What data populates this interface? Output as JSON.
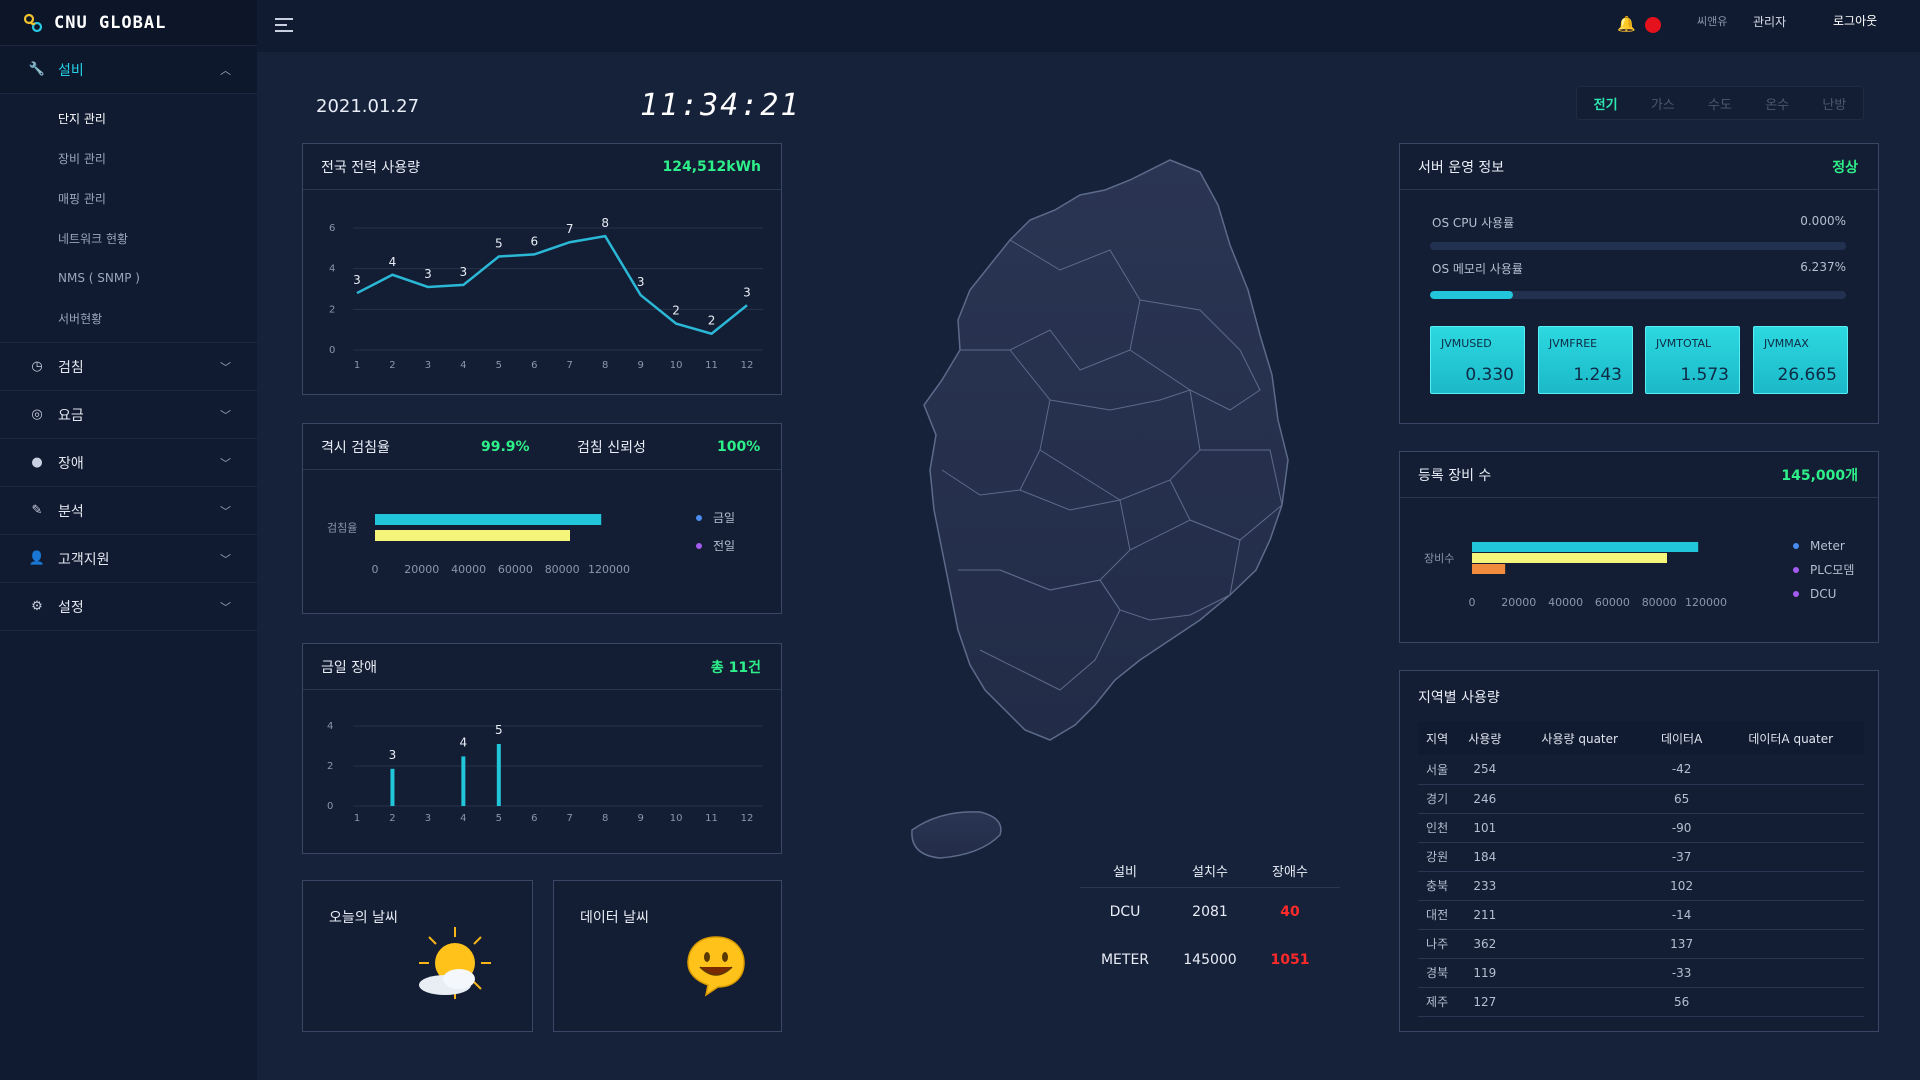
{
  "brand": {
    "name": "CNU GLOBAL"
  },
  "sidebar": {
    "groups": [
      {
        "label": "설비",
        "icon": "wrench-icon",
        "expanded": true,
        "items": [
          "단지 관리",
          "장비 관리",
          "매핑 관리",
          "네트워크 현황",
          "NMS ( SNMP )",
          "서버현황"
        ]
      },
      {
        "label": "검침",
        "icon": "gauge-icon"
      },
      {
        "label": "요금",
        "icon": "coins-icon"
      },
      {
        "label": "장애",
        "icon": "alert-icon"
      },
      {
        "label": "분석",
        "icon": "pencil-icon"
      },
      {
        "label": "고객지원",
        "icon": "user-icon"
      },
      {
        "label": "설정",
        "icon": "gear-icon"
      }
    ]
  },
  "header": {
    "user": "씨앤유",
    "role": "관리자",
    "logout": "로그아웃"
  },
  "datetime": {
    "date": "2021.01.27",
    "time": "11:34:21"
  },
  "utility_tabs": [
    "전기",
    "가스",
    "수도",
    "온수",
    "난방"
  ],
  "active_utility": "전기",
  "power_panel": {
    "title": "전국 전력 사용량",
    "total": "124,512kWh",
    "chart_data": {
      "type": "line",
      "x": [
        1,
        2,
        3,
        4,
        5,
        6,
        7,
        8,
        9,
        10,
        11,
        12
      ],
      "values": [
        3,
        4,
        3,
        3,
        5,
        6,
        7,
        8,
        3,
        2,
        2,
        3
      ],
      "line_y": [
        2.8,
        3.7,
        3.1,
        3.2,
        4.6,
        4.7,
        5.3,
        5.6,
        2.7,
        1.3,
        0.8,
        2.2
      ],
      "yticks": [
        0,
        2,
        4,
        6
      ],
      "ylim": [
        0,
        6
      ],
      "color": "#2bb7d6"
    }
  },
  "reading_panel": {
    "title1": "격시 검침율",
    "value1": "99.9%",
    "title2": "검침 신뢰성",
    "value2": "100%",
    "row_label": "검침율",
    "chart_data": {
      "type": "bar",
      "orientation": "horizontal",
      "series": [
        {
          "name": "금일",
          "value": 116000,
          "color": "#22c6db"
        },
        {
          "name": "전일",
          "value": 100000,
          "color": "#f4f57a"
        }
      ],
      "xticks": [
        0,
        20000,
        40000,
        60000,
        80000,
        120000
      ],
      "xlim": [
        0,
        120000
      ]
    }
  },
  "fault_panel": {
    "title": "금일 장애",
    "total": "총 11건",
    "chart_data": {
      "type": "bar",
      "x": [
        1,
        2,
        3,
        4,
        5,
        6,
        7,
        8,
        9,
        10,
        11,
        12
      ],
      "values": [
        0,
        3,
        0,
        4,
        5,
        0,
        0,
        0,
        0,
        0,
        0,
        0
      ],
      "yticks": [
        0,
        2,
        4
      ],
      "ylim": [
        0,
        4
      ],
      "color": "#22c6db"
    }
  },
  "weather": {
    "today": "오늘의 날씨",
    "data": "데이터 날씨"
  },
  "server_panel": {
    "title": "서버 운영 정보",
    "status": "정상",
    "cpu_label": "OS CPU 사용률",
    "cpu_value": "0.000%",
    "cpu_fraction": 0.0,
    "mem_label": "OS 메모리 사용률",
    "mem_value": "6.237%",
    "mem_fraction": 0.2,
    "jvm": [
      {
        "label": "JVMUSED",
        "value": "0.330"
      },
      {
        "label": "JVMFREE",
        "value": "1.243"
      },
      {
        "label": "JVMTOTAL",
        "value": "1.573"
      },
      {
        "label": "JVMMAX",
        "value": "26.665"
      }
    ]
  },
  "equipment_panel": {
    "title": "등록 장비 수",
    "total": "145,000개",
    "row_label": "장비수",
    "chart_data": {
      "type": "bar",
      "orientation": "horizontal",
      "series": [
        {
          "name": "Meter",
          "value": 116000,
          "color": "#22c6db"
        },
        {
          "name": "PLC모뎀",
          "value": 100000,
          "color": "#f4f57a"
        },
        {
          "name": "DCU",
          "value": 17000,
          "color": "#f08c3b"
        }
      ],
      "xticks": [
        0,
        20000,
        40000,
        60000,
        80000,
        120000
      ],
      "xlim": [
        0,
        120000
      ]
    }
  },
  "region_panel": {
    "title": "지역별 사용량",
    "columns": [
      "지역",
      "사용량",
      "사용량 quater",
      "데이터A",
      "데이터A quater"
    ],
    "rows": [
      [
        "서울",
        "254",
        "",
        "-42",
        ""
      ],
      [
        "경기",
        "246",
        "",
        "65",
        ""
      ],
      [
        "인천",
        "101",
        "",
        "-90",
        ""
      ],
      [
        "강원",
        "184",
        "",
        "-37",
        ""
      ],
      [
        "충북",
        "233",
        "",
        "102",
        ""
      ],
      [
        "대전",
        "211",
        "",
        "-14",
        ""
      ],
      [
        "나주",
        "362",
        "",
        "137",
        ""
      ],
      [
        "경북",
        "119",
        "",
        "-33",
        ""
      ],
      [
        "제주",
        "127",
        "",
        "56",
        ""
      ]
    ]
  },
  "facility_table": {
    "columns": [
      "설비",
      "설치수",
      "장애수"
    ],
    "rows": [
      [
        "DCU",
        "2081",
        "40"
      ],
      [
        "METER",
        "145000",
        "1051"
      ]
    ]
  }
}
